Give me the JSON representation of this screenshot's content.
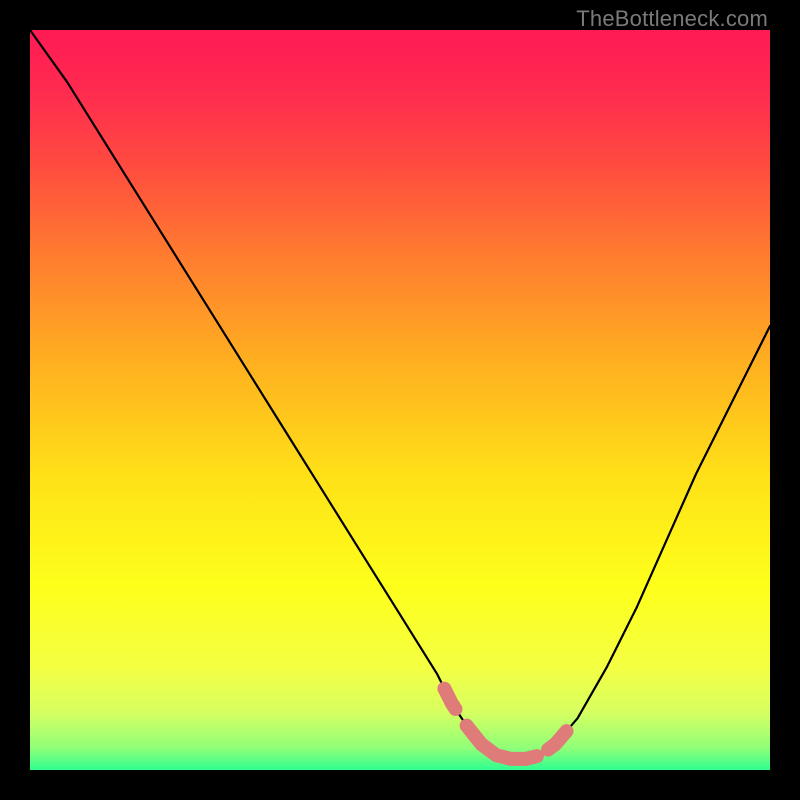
{
  "watermark": "TheBottleneck.com",
  "colors": {
    "bg": "#000000",
    "gradient_stops": [
      {
        "offset": 0.0,
        "color": "#ff1a54"
      },
      {
        "offset": 0.08,
        "color": "#ff2a50"
      },
      {
        "offset": 0.18,
        "color": "#ff4a40"
      },
      {
        "offset": 0.3,
        "color": "#ff7a30"
      },
      {
        "offset": 0.45,
        "color": "#ffb020"
      },
      {
        "offset": 0.6,
        "color": "#ffe018"
      },
      {
        "offset": 0.75,
        "color": "#fdff1a"
      },
      {
        "offset": 0.86,
        "color": "#f4ff42"
      },
      {
        "offset": 0.92,
        "color": "#d8ff60"
      },
      {
        "offset": 0.97,
        "color": "#90ff78"
      },
      {
        "offset": 1.0,
        "color": "#30ff90"
      }
    ],
    "curve": "#000000",
    "marker": "#df7b79"
  },
  "chart_data": {
    "type": "line",
    "title": "",
    "xlabel": "",
    "ylabel": "",
    "xlim": [
      0,
      100
    ],
    "ylim": [
      0,
      100
    ],
    "grid": false,
    "legend": false,
    "series": [
      {
        "name": "bottleneck-curve",
        "x": [
          0,
          5,
          10,
          15,
          20,
          25,
          30,
          35,
          40,
          45,
          50,
          55,
          57,
          59,
          61,
          63,
          65,
          67,
          69,
          71,
          74,
          78,
          82,
          86,
          90,
          95,
          100
        ],
        "y": [
          100,
          93,
          85,
          77,
          69,
          61,
          53,
          45,
          37,
          29,
          21,
          13,
          9,
          6,
          3.5,
          2,
          1.5,
          1.5,
          2,
          3.5,
          7,
          14,
          22,
          31,
          40,
          50,
          60
        ]
      }
    ],
    "markers": [
      {
        "name": "highlight-left",
        "x_range": [
          56.0,
          57.5
        ],
        "y_range": [
          6.0,
          10.0
        ]
      },
      {
        "name": "highlight-flat",
        "x_range": [
          59.0,
          68.5
        ],
        "y_range": [
          1.0,
          2.5
        ]
      },
      {
        "name": "highlight-right",
        "x_range": [
          70.0,
          72.5
        ],
        "y_range": [
          3.0,
          6.5
        ]
      }
    ],
    "annotations": []
  }
}
